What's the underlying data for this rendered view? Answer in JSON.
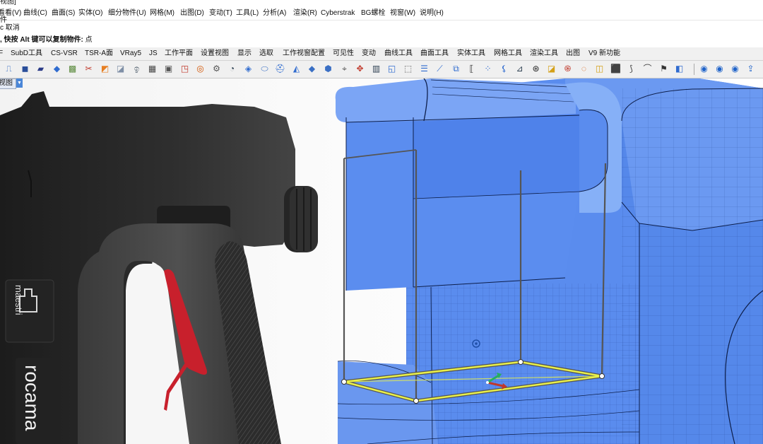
{
  "window": {
    "title_fragment": "视图]"
  },
  "menu": [
    "看看(V)",
    "曲线(C)",
    "曲面(S)",
    "实体(O)",
    "细分物件(U)",
    "网格(M)",
    "出图(D)",
    "变动(T)",
    "工具(L)",
    "分析(A)",
    "渲染(R)",
    "Cyberstrak",
    "BG螺栓",
    "视窗(W)",
    "说明(H)"
  ],
  "command": {
    "line1": "件",
    "line2": "c 取消",
    "prompt": ", 快按 Alt 键可以复制物件:",
    "prompt_suffix": "点"
  },
  "toolbar_tabs": [
    "SubD工具",
    "CS-VSR",
    "TSR-A面",
    "VRay5",
    "JS",
    "工作平面",
    "设置视图",
    "显示",
    "选取",
    "工作视窗配置",
    "可见性",
    "变动",
    "曲线工具",
    "曲面工具",
    "实体工具",
    "网格工具",
    "渲染工具",
    "出图",
    "V9 新功能"
  ],
  "tools": [
    {
      "name": "new-document-icon",
      "glyph": "⎍",
      "color": "#3a6fc4"
    },
    {
      "name": "box-icon",
      "glyph": "◼",
      "color": "#2a4e9a"
    },
    {
      "name": "car-icon",
      "glyph": "▰",
      "color": "#2c3c88"
    },
    {
      "name": "shaded-view-icon",
      "glyph": "◆",
      "color": "#2f6bcf"
    },
    {
      "name": "render-image-icon",
      "glyph": "▩",
      "color": "#5a8a3c"
    },
    {
      "name": "scissors-icon",
      "glyph": "✂",
      "color": "#c0392b"
    },
    {
      "name": "rainbow-icon",
      "glyph": "◩",
      "color": "#e67e22"
    },
    {
      "name": "paint-bucket-icon",
      "glyph": "◪",
      "color": "#7f8fa6"
    },
    {
      "name": "spray-icon",
      "glyph": "ඉ",
      "color": "#2c3e50"
    },
    {
      "name": "checker-icon",
      "glyph": "▦",
      "color": "#444444"
    },
    {
      "name": "camera-icon",
      "glyph": "▣",
      "color": "#555555"
    },
    {
      "name": "arrow-box-icon",
      "glyph": "◳",
      "color": "#c0392b"
    },
    {
      "name": "target-icon",
      "glyph": "◎",
      "color": "#d35400"
    },
    {
      "name": "gear-icon",
      "glyph": "⚙",
      "color": "#555555"
    },
    {
      "name": "sphere-cut-icon",
      "glyph": "◔",
      "color": "#2c3e50"
    },
    {
      "name": "diamond-icon",
      "glyph": "◈",
      "color": "#2f6bcf"
    },
    {
      "name": "cylinder-icon",
      "glyph": "⬭",
      "color": "#3a6fc4"
    },
    {
      "name": "hat-icon",
      "glyph": "⛑",
      "color": "#2f6bcf"
    },
    {
      "name": "plane-icon",
      "glyph": "◭",
      "color": "#2f6bcf"
    },
    {
      "name": "rhombus-icon",
      "glyph": "◆",
      "color": "#3a6fc4"
    },
    {
      "name": "cube-icon",
      "glyph": "⬢",
      "color": "#3a6fc4"
    },
    {
      "name": "lasso-icon",
      "glyph": "⌖",
      "color": "#555555"
    },
    {
      "name": "move-gumball-icon",
      "glyph": "✥",
      "color": "#c0392b"
    },
    {
      "name": "image-frame-icon",
      "glyph": "▥",
      "color": "#2c3e50"
    },
    {
      "name": "pen-plane-icon",
      "glyph": "◱",
      "color": "#2f6bcf"
    },
    {
      "name": "dashed-select-icon",
      "glyph": "⬚",
      "color": "#555555"
    },
    {
      "name": "layers-icon",
      "glyph": "☰",
      "color": "#2f6bcf"
    },
    {
      "name": "tilt-icon",
      "glyph": "⟋",
      "color": "#2f6bcf"
    },
    {
      "name": "mirror-icon",
      "glyph": "⧉",
      "color": "#2f6bcf"
    },
    {
      "name": "bracket-icon",
      "glyph": "⟦",
      "color": "#333333"
    },
    {
      "name": "dots-icon",
      "glyph": "⁘",
      "color": "#2f6bcf"
    },
    {
      "name": "wand-icon",
      "glyph": "⚸",
      "color": "#2f6bcf"
    },
    {
      "name": "brush-icon",
      "glyph": "⊿",
      "color": "#2c3e50"
    },
    {
      "name": "compass-icon",
      "glyph": "⊛",
      "color": "#222222"
    },
    {
      "name": "contrast-icon",
      "glyph": "◪",
      "color": "#d4a017"
    },
    {
      "name": "spiral-icon",
      "glyph": "֍",
      "color": "#c0392b"
    },
    {
      "name": "zebra-icon",
      "glyph": "◌",
      "color": "#d35400"
    },
    {
      "name": "tape-icon",
      "glyph": "◫",
      "color": "#d4a017"
    },
    {
      "name": "box-yellow-icon",
      "glyph": "⬛",
      "color": "#d4a017"
    },
    {
      "name": "curve-tool-icon",
      "glyph": "⟆",
      "color": "#444444"
    },
    {
      "name": "arc-icon",
      "glyph": "⌒",
      "color": "#444444"
    },
    {
      "name": "person-icon",
      "glyph": "⚑",
      "color": "#333333"
    },
    {
      "name": "cube-blue-icon",
      "glyph": "◧",
      "color": "#2f6bcf"
    },
    {
      "name": "display-mode-1-icon",
      "glyph": "◉",
      "color": "#1f63c9"
    },
    {
      "name": "display-mode-2-icon",
      "glyph": "◉",
      "color": "#1f63c9"
    },
    {
      "name": "display-mode-3-icon",
      "glyph": "◉",
      "color": "#1f63c9"
    },
    {
      "name": "upload-icon",
      "glyph": "⇪",
      "color": "#1f63c9"
    }
  ],
  "viewport": {
    "tab_label": "视图"
  },
  "product": {
    "brand_text": "maestri",
    "model_text": "rocama"
  },
  "colors": {
    "model_blue": "#5b8def",
    "model_blue_light": "#7fa9f4",
    "model_blue_dark": "#2f63c8",
    "cage_edge": "#555555",
    "selected_edge": "#e9f04a",
    "trigger_red": "#c8202c",
    "tool_body": "#2b2b2b"
  }
}
